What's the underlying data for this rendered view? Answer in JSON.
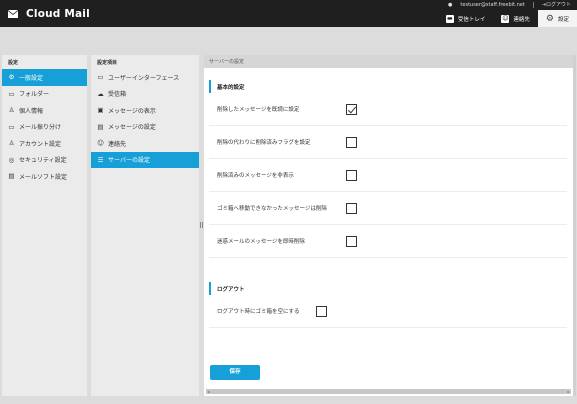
{
  "header": {
    "app_name": "Cloud Mail",
    "user_email": "testuser@staff.freebit.net",
    "logout_label": "ログアウト",
    "nav": [
      {
        "label": "受信トレイ",
        "icon": "inbox-icon"
      },
      {
        "label": "連絡先",
        "icon": "contacts-icon"
      },
      {
        "label": "設定",
        "icon": "gear-icon"
      }
    ]
  },
  "col1": {
    "title": "設定",
    "items": [
      {
        "label": "一般設定",
        "icon": "gear-icon",
        "active": true
      },
      {
        "label": "フォルダー",
        "icon": "folder-icon"
      },
      {
        "label": "個人情報",
        "icon": "person-icon"
      },
      {
        "label": "メール振り分け",
        "icon": "filter-folder-icon"
      },
      {
        "label": "アカウント設定",
        "icon": "account-icon"
      },
      {
        "label": "セキュリティ設定",
        "icon": "shield-icon"
      },
      {
        "label": "メールソフト設定",
        "icon": "mail-client-icon"
      }
    ]
  },
  "col2": {
    "title": "設定項目",
    "items": [
      {
        "label": "ユーザーインターフェース",
        "icon": "monitor-icon"
      },
      {
        "label": "受信箱",
        "icon": "cloud-inbox-icon"
      },
      {
        "label": "メッセージの表示",
        "icon": "message-view-icon"
      },
      {
        "label": "メッセージの設定",
        "icon": "message-settings-icon"
      },
      {
        "label": "連絡先",
        "icon": "contacts-icon"
      },
      {
        "label": "サーバーの設定",
        "icon": "server-icon",
        "active": true
      }
    ]
  },
  "main": {
    "header": "サーバーの設定",
    "basic": {
      "title": "基本的設定",
      "rows": [
        {
          "label": "削除したメッセージを既読に設定",
          "checked": true
        },
        {
          "label": "削除の代わりに削除済みフラグを設定",
          "checked": false
        },
        {
          "label": "削除済みのメッセージを非表示",
          "checked": false
        },
        {
          "label": "ゴミ箱へ移動できなかったメッセージは削除",
          "checked": false
        },
        {
          "label": "迷惑メールのメッセージを即時削除",
          "checked": false
        }
      ]
    },
    "logout": {
      "title": "ログアウト",
      "rows": [
        {
          "label": "ログアウト時にゴミ箱を空にする",
          "checked": false
        }
      ]
    },
    "save_label": "保存"
  },
  "colors": {
    "accent": "#17a0d8",
    "topbar": "#1f1f1f"
  }
}
